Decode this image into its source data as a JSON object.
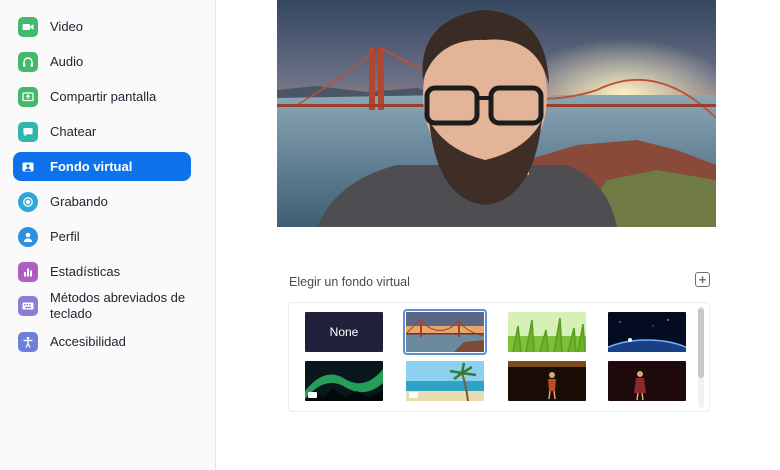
{
  "sidebar": {
    "items": [
      {
        "label": "Video",
        "icon": "video-icon",
        "color": "#42b96d"
      },
      {
        "label": "Audio",
        "icon": "headphones-icon",
        "color": "#42b96d"
      },
      {
        "label": "Compartir pantalla",
        "icon": "share-screen-icon",
        "color": "#42b96d"
      },
      {
        "label": "Chatear",
        "icon": "chat-icon",
        "color": "#2fb6b0"
      },
      {
        "label": "Fondo virtual",
        "icon": "virtual-background-icon",
        "color": "#ffffff",
        "active": true
      },
      {
        "label": "Grabando",
        "icon": "record-icon",
        "color": "#2ea6d8"
      },
      {
        "label": "Perfil",
        "icon": "profile-icon",
        "color": "#2e8fe0"
      },
      {
        "label": "Estadísticas",
        "icon": "statistics-icon",
        "color": "#b05dc4"
      },
      {
        "label": "Métodos abreviados de teclado",
        "icon": "keyboard-icon",
        "color": "#8e7bd6"
      },
      {
        "label": "Accesibilidad",
        "icon": "accessibility-icon",
        "color": "#6e7fd9"
      }
    ]
  },
  "main": {
    "chooser_title": "Elegir un fondo virtual",
    "add_button_label": "+",
    "thumbnails": [
      {
        "name": "none",
        "label": "None",
        "selected": false,
        "video": false
      },
      {
        "name": "golden-gate-bridge",
        "label": "",
        "selected": true,
        "video": false
      },
      {
        "name": "grass",
        "label": "",
        "selected": false,
        "video": false
      },
      {
        "name": "earth-from-space",
        "label": "",
        "selected": false,
        "video": false
      },
      {
        "name": "aurora",
        "label": "",
        "selected": false,
        "video": true
      },
      {
        "name": "beach-palm",
        "label": "",
        "selected": false,
        "video": true
      },
      {
        "name": "dancer-stage-1",
        "label": "",
        "selected": false,
        "video": false
      },
      {
        "name": "dancer-stage-2",
        "label": "",
        "selected": false,
        "video": false
      }
    ]
  },
  "colors": {
    "accent": "#0e72ed",
    "selection_outline": "#5b8fd8"
  }
}
